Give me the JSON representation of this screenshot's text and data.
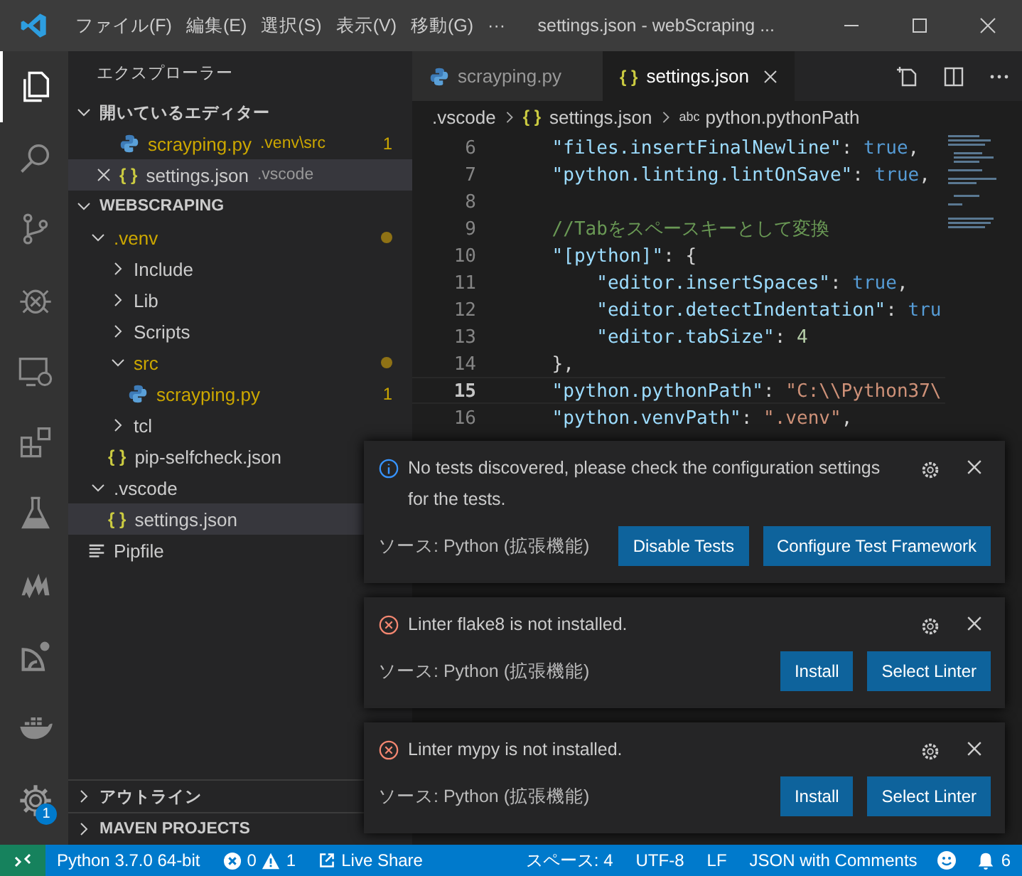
{
  "title_bar": {
    "menu": [
      "ファイル(F)",
      "編集(E)",
      "選択(S)",
      "表示(V)",
      "移動(G)",
      "···"
    ],
    "title": "settings.json - webScraping ..."
  },
  "activity_bar": {
    "items": [
      {
        "kind": "files",
        "selected": true
      },
      {
        "kind": "search",
        "selected": false
      },
      {
        "kind": "source-control",
        "selected": false
      },
      {
        "kind": "debug",
        "selected": false
      },
      {
        "kind": "remote",
        "selected": false
      },
      {
        "kind": "extensions",
        "selected": false
      },
      {
        "kind": "testing",
        "selected": false
      },
      {
        "kind": "maven",
        "selected": false
      },
      {
        "kind": "arc",
        "selected": false
      },
      {
        "kind": "docker",
        "selected": false
      }
    ],
    "settings_badge": "1"
  },
  "sidebar": {
    "title": "エクスプローラー",
    "open_editors": {
      "title": "開いているエディター",
      "expanded": true,
      "items": [
        {
          "label": "scrayping.py",
          "kind": "python",
          "path": ".venv\\src",
          "problem": true,
          "badge": "1",
          "selected": false
        },
        {
          "label": "settings.json",
          "kind": "json",
          "icon": "{ }",
          "path": ".vscode",
          "problem": false,
          "selected": true
        }
      ]
    },
    "workspace": {
      "title": "WEBSCRAPING",
      "expanded": true,
      "tree": [
        {
          "label": ".venv",
          "kind": "folder",
          "expanded": true,
          "problem": true,
          "selected": false,
          "children": [
            {
              "label": "Include",
              "kind": "folder",
              "expanded": false,
              "problem": false,
              "selected": false
            },
            {
              "label": "Lib",
              "kind": "folder",
              "expanded": false,
              "problem": false,
              "selected": false
            },
            {
              "label": "Scripts",
              "kind": "folder",
              "expanded": false,
              "problem": false,
              "selected": false
            },
            {
              "label": "src",
              "kind": "folder",
              "expanded": true,
              "problem": true,
              "selected": false,
              "children": [
                {
                  "label": "scrayping.py",
                  "kind": "python",
                  "problem": true,
                  "badge": "1",
                  "selected": false
                }
              ]
            },
            {
              "label": "tcl",
              "kind": "folder",
              "expanded": false,
              "problem": false,
              "selected": false
            },
            {
              "label": "pip-selfcheck.json",
              "kind": "json",
              "icon": "{ }",
              "problem": false,
              "selected": false
            }
          ]
        },
        {
          "label": ".vscode",
          "kind": "folder",
          "expanded": true,
          "problem": false,
          "selected": false,
          "children": [
            {
              "label": "settings.json",
              "kind": "json",
              "icon": "{ }",
              "problem": false,
              "selected": true
            }
          ]
        },
        {
          "label": "Pipfile",
          "kind": "text",
          "problem": false,
          "selected": false
        }
      ]
    },
    "sections": [
      {
        "title": "アウトライン",
        "expanded": false
      },
      {
        "title": "MAVEN PROJECTS",
        "expanded": false
      }
    ]
  },
  "editor": {
    "tabs": [
      {
        "label": "scrayping.py",
        "kind": "python",
        "selected": false
      },
      {
        "label": "settings.json",
        "kind": "json",
        "icon": "{ }",
        "selected": true
      }
    ],
    "breadcrumbs": [
      {
        "kind": "folder",
        "label": ".vscode"
      },
      {
        "kind": "json",
        "icon": "{ }",
        "label": "settings.json"
      },
      {
        "kind": "property",
        "symbol": "abc",
        "label": "python.pythonPath"
      }
    ],
    "lines": [
      {
        "n": "6",
        "current": false,
        "tokens": [
          {
            "kind": "key",
            "text": "    \"files.insertFinalNewline\""
          },
          {
            "kind": "punct",
            "text": ": "
          },
          {
            "kind": "bool",
            "text": "true"
          },
          {
            "kind": "punct",
            "text": ","
          }
        ]
      },
      {
        "n": "7",
        "current": false,
        "tokens": [
          {
            "kind": "key",
            "text": "    \"python.linting.lintOnSave\""
          },
          {
            "kind": "punct",
            "text": ": "
          },
          {
            "kind": "bool",
            "text": "true"
          },
          {
            "kind": "punct",
            "text": ","
          }
        ]
      },
      {
        "n": "8",
        "current": false
      },
      {
        "n": "9",
        "current": false,
        "tokens": [
          {
            "kind": "comment",
            "text": "    //Tabをスペースキーとして変換"
          }
        ]
      },
      {
        "n": "10",
        "current": false,
        "tokens": [
          {
            "kind": "key",
            "text": "    \"[python]\""
          },
          {
            "kind": "punct",
            "text": ": {"
          }
        ]
      },
      {
        "n": "11",
        "current": false,
        "tokens": [
          {
            "kind": "key",
            "text": "        \"editor.insertSpaces\""
          },
          {
            "kind": "punct",
            "text": ": "
          },
          {
            "kind": "bool",
            "text": "true"
          },
          {
            "kind": "punct",
            "text": ","
          }
        ]
      },
      {
        "n": "12",
        "current": false,
        "tokens": [
          {
            "kind": "key",
            "text": "        \"editor.detectIndentation\""
          },
          {
            "kind": "punct",
            "text": ": "
          },
          {
            "kind": "bool",
            "text": "tru"
          }
        ]
      },
      {
        "n": "13",
        "current": false,
        "tokens": [
          {
            "kind": "key",
            "text": "        \"editor.tabSize\""
          },
          {
            "kind": "punct",
            "text": ": "
          },
          {
            "kind": "number",
            "text": "4"
          }
        ]
      },
      {
        "n": "14",
        "current": false,
        "tokens": [
          {
            "kind": "punct",
            "text": "    },"
          }
        ]
      },
      {
        "n": "15",
        "current": true,
        "tokens": [
          {
            "kind": "key",
            "text": "    \"python.pythonPath\""
          },
          {
            "kind": "punct",
            "text": ": "
          },
          {
            "kind": "string",
            "text": "\"C:\\\\Python37\\"
          }
        ]
      },
      {
        "n": "16",
        "current": false,
        "tokens": [
          {
            "kind": "key",
            "text": "    \"python.venvPath\""
          },
          {
            "kind": "punct",
            "text": ": "
          },
          {
            "kind": "string",
            "text": "\".venv\""
          },
          {
            "kind": "punct",
            "text": ","
          }
        ]
      }
    ]
  },
  "notifications": [
    {
      "kind": "info",
      "message": "No tests discovered, please check the configuration settings for the tests.",
      "source": "ソース: Python (拡張機能)",
      "buttons": [
        "Disable Tests",
        "Configure Test Framework"
      ]
    },
    {
      "kind": "error",
      "message": "Linter flake8 is not installed.",
      "source": "ソース: Python (拡張機能)",
      "buttons": [
        "Install",
        "Select Linter"
      ]
    },
    {
      "kind": "error",
      "message": "Linter mypy is not installed.",
      "source": "ソース: Python (拡張機能)",
      "buttons": [
        "Install",
        "Select Linter"
      ]
    }
  ],
  "status_bar": {
    "interpreter": "Python 3.7.0 64-bit",
    "errors": "0",
    "warnings": "1",
    "live_share": "Live Share",
    "right": [
      "スペース: 4",
      "UTF-8",
      "LF",
      "JSON with Comments"
    ],
    "notifications_count": "6"
  }
}
